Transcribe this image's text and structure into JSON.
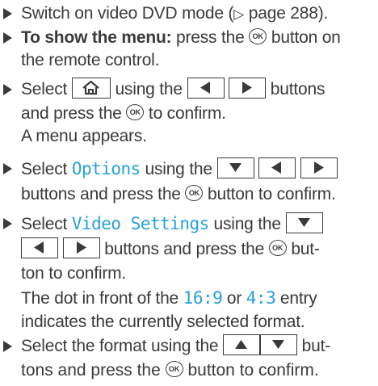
{
  "steps": [
    {
      "lines": [
        [
          "Switch on video DVD mode (",
          "▷",
          " page 288)."
        ]
      ]
    },
    {
      "bold_label": "To show the menu:",
      "text1": " press the ",
      "text2": " button on",
      "text3": "the remote control."
    },
    {
      "text1": "Select ",
      "text2": " using the ",
      "text3": " buttons",
      "text4": "and press the ",
      "text5": " to confirm.",
      "text6": "A menu appears."
    },
    {
      "text1": "Select ",
      "mono": "Options",
      "text2": " using the ",
      "text3": "buttons and press the ",
      "text4": " button to confirm."
    },
    {
      "text1": "Select ",
      "mono": "Video Settings",
      "text2": " using the ",
      "text3": " buttons and press the ",
      "text4": " but-",
      "text5": "ton to confirm.",
      "text6": "The dot in front of the ",
      "mono2": "16:9",
      "text7": " or ",
      "mono3": "4:3",
      "text8": " entry",
      "text9": "indicates the currently selected format."
    },
    {
      "text1": "Select the format using the ",
      "text2": " but-",
      "text3": "tons and press the ",
      "text4": " button to confirm."
    }
  ],
  "ok_label": "OK",
  "accent_color": "#27a0d8",
  "icons": {
    "home": "home-icon",
    "left": "left-arrow-icon",
    "right": "right-arrow-icon",
    "up": "up-arrow-icon",
    "down": "down-arrow-icon"
  }
}
